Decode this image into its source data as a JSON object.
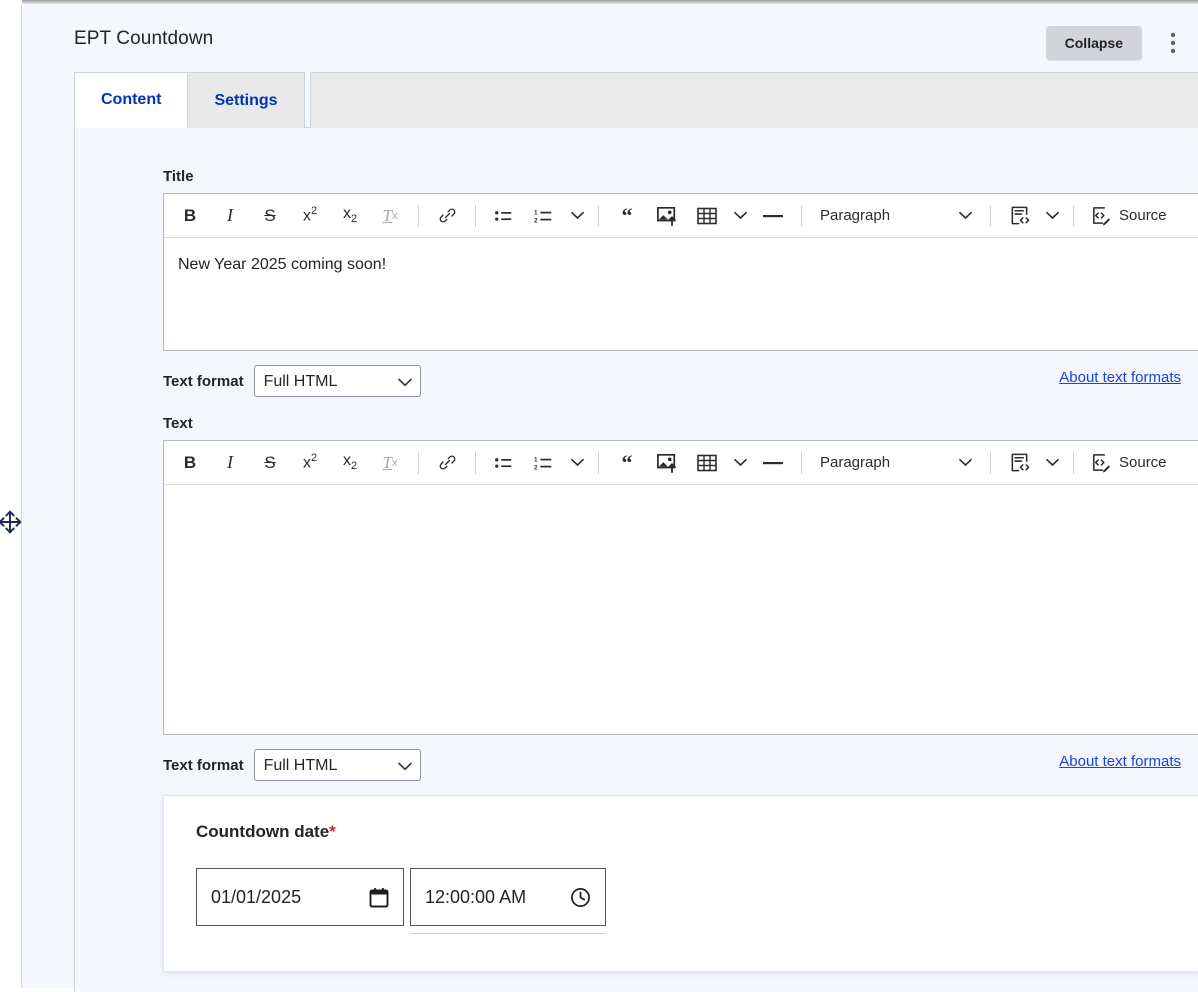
{
  "paragraph": {
    "title": "EPT Countdown",
    "collapse_label": "Collapse",
    "more_menu": "vertical-ellipsis"
  },
  "tabs": [
    {
      "label": "Content",
      "active": true
    },
    {
      "label": "Settings",
      "active": false
    }
  ],
  "fields": {
    "title": {
      "label": "Title",
      "value": "New Year 2025 coming soon!",
      "format_label": "Text format",
      "format_value": "Full HTML",
      "format_options": [
        "Full HTML"
      ],
      "about_link": "About text formats"
    },
    "text": {
      "label": "Text",
      "value": "",
      "format_label": "Text format",
      "format_value": "Full HTML",
      "format_options": [
        "Full HTML"
      ],
      "about_link": "About text formats"
    }
  },
  "countdown": {
    "label": "Countdown date",
    "required_marker": "*",
    "date_value": "01/01/2025",
    "date_placeholder": "mm/dd/yyyy",
    "time_value": "12:00:00 AM",
    "time_placeholder": "--:--:-- --",
    "date_icon": "calendar-icon",
    "time_icon": "clock-icon"
  },
  "editor_toolbar": {
    "bold": "B",
    "italic": "I",
    "strikethrough": "S",
    "superscript": "x",
    "superscript_exp": "2",
    "subscript": "x",
    "subscript_exp": "2",
    "remove_format": "T",
    "remove_format_exp": "x",
    "link": "link-icon",
    "bulleted_list": "bulleted-list-icon",
    "numbered_list": "numbered-list-icon",
    "list_dropdown": "chevron-down-icon",
    "block_quote": "“",
    "insert_image": "image-upload-icon",
    "insert_table": "table-icon",
    "table_dropdown": "chevron-down-icon",
    "horizontal_line": "horizontal-rule-icon",
    "paragraph_style": "Paragraph",
    "paragraph_dropdown": "chevron-down-icon",
    "code_block": "code-block-icon",
    "code_block_dropdown": "chevron-down-icon",
    "source_label": "Source",
    "source_icon": "source-editing-icon"
  },
  "colors": {
    "page_bg": "#f4f7fd",
    "panel_white": "#ffffff",
    "tab_active_text": "#0036b1",
    "link": "#1a41e6",
    "required": "#d72222",
    "collapse_bg": "#d3d4d9",
    "time_underline": "#b7d8cf"
  }
}
